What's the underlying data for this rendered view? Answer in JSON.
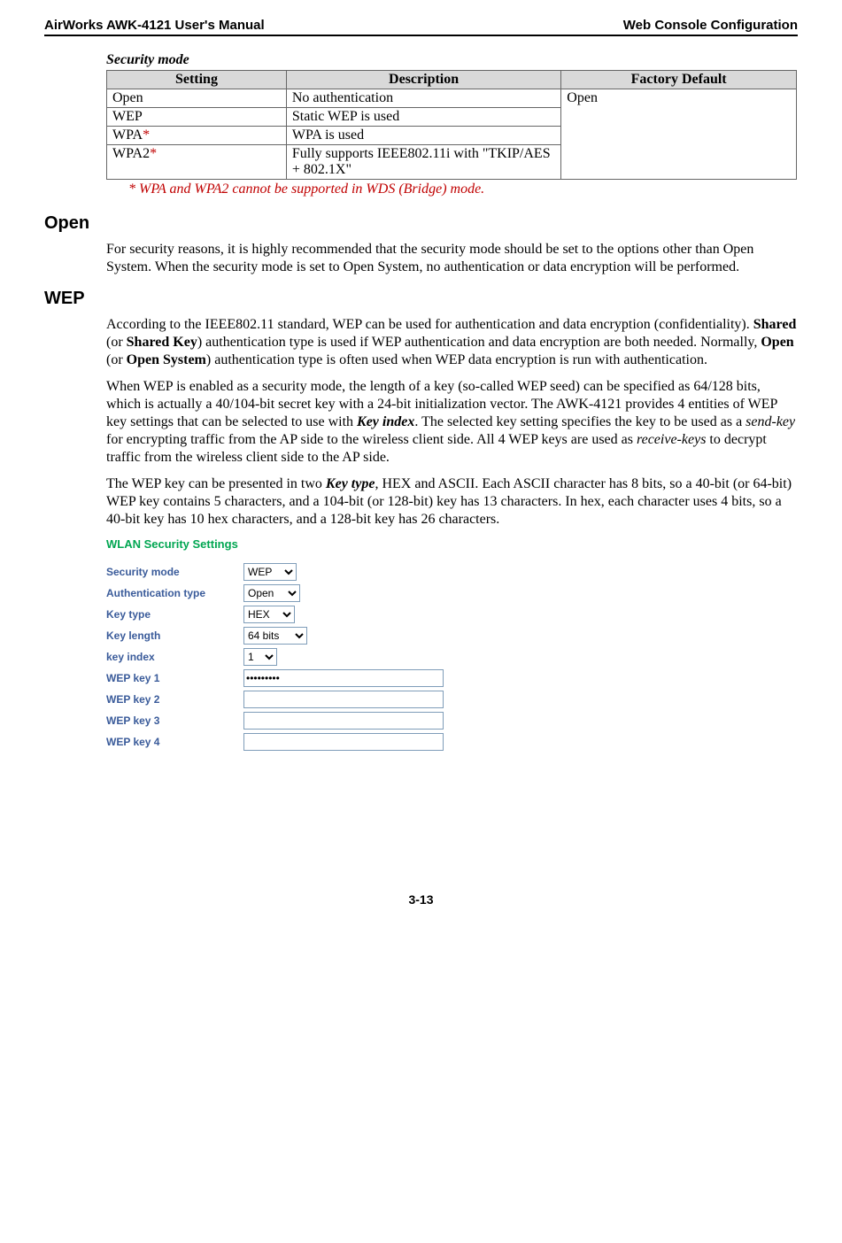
{
  "header": {
    "left": "AirWorks AWK-4121 User's Manual",
    "right": "Web Console Configuration"
  },
  "secmode": {
    "title": "Security mode",
    "cols": [
      "Setting",
      "Description",
      "Factory Default"
    ],
    "rows": [
      {
        "setting": "Open",
        "desc": "No authentication"
      },
      {
        "setting": "WEP",
        "desc": "Static WEP is used"
      },
      {
        "setting_pre": "WPA",
        "star": "*",
        "desc": "WPA is used"
      },
      {
        "setting_pre": "WPA2",
        "star": "*",
        "desc": "Fully supports IEEE802.11i with \"TKIP/AES + 802.1X\""
      }
    ],
    "default": "Open",
    "footnote": "* WPA and WPA2 cannot be supported in WDS (Bridge) mode."
  },
  "open": {
    "heading": "Open",
    "p1": "For security reasons, it is highly recommended that the security mode should be set to the options other than Open System. When the security mode is set to Open System, no authentication or data encryption will be performed."
  },
  "wep": {
    "heading": "WEP",
    "p1a": "According to the IEEE802.11 standard, WEP can be used for authentication and data encryption (confidentiality). ",
    "p1b": "Shared",
    "p1c": " (or ",
    "p1d": "Shared Key",
    "p1e": ") authentication type is used if WEP authentication and data encryption are both needed. Normally, ",
    "p1f": "Open",
    "p1g": " (or ",
    "p1h": "Open System",
    "p1i": ") authentication type is often used when WEP data encryption is run with authentication.",
    "p2a": "When WEP is enabled as a security mode, the length of a key (so-called WEP seed) can be specified as 64/128 bits, which is actually a 40/104-bit secret key with a 24-bit initialization vector. The AWK-4121 provides 4 entities of WEP key settings that can be selected to use with ",
    "p2b": "Key index",
    "p2c": ". The selected key setting specifies the key to be used as a ",
    "p2d": "send-key",
    "p2e": " for encrypting traffic from the AP side to the wireless client side. All 4 WEP keys are used as ",
    "p2f": "receive-keys",
    "p2g": " to decrypt traffic from the wireless client side to the AP side.",
    "p3a": "The WEP key can be presented in two ",
    "p3b": "Key type",
    "p3c": ", HEX and ASCII. Each ASCII character has 8 bits, so a 40-bit (or 64-bit) WEP key contains 5 characters, and a 104-bit (or 128-bit) key has 13 characters. In hex, each character uses 4 bits, so a 40-bit key has 10 hex characters, and a 128-bit key has 26 characters."
  },
  "form": {
    "title": "WLAN Security Settings",
    "labels": {
      "secmode": "Security mode",
      "authtype": "Authentication type",
      "keytype": "Key type",
      "keylen": "Key length",
      "keyidx": "key index",
      "wk1": "WEP key 1",
      "wk2": "WEP key 2",
      "wk3": "WEP key 3",
      "wk4": "WEP key 4"
    },
    "values": {
      "secmode": "WEP",
      "authtype": "Open",
      "keytype": "HEX",
      "keylen": "64 bits",
      "keyidx": "1",
      "wk1": "•••••••••",
      "wk2": "",
      "wk3": "",
      "wk4": ""
    }
  },
  "pagenum": "3-13"
}
